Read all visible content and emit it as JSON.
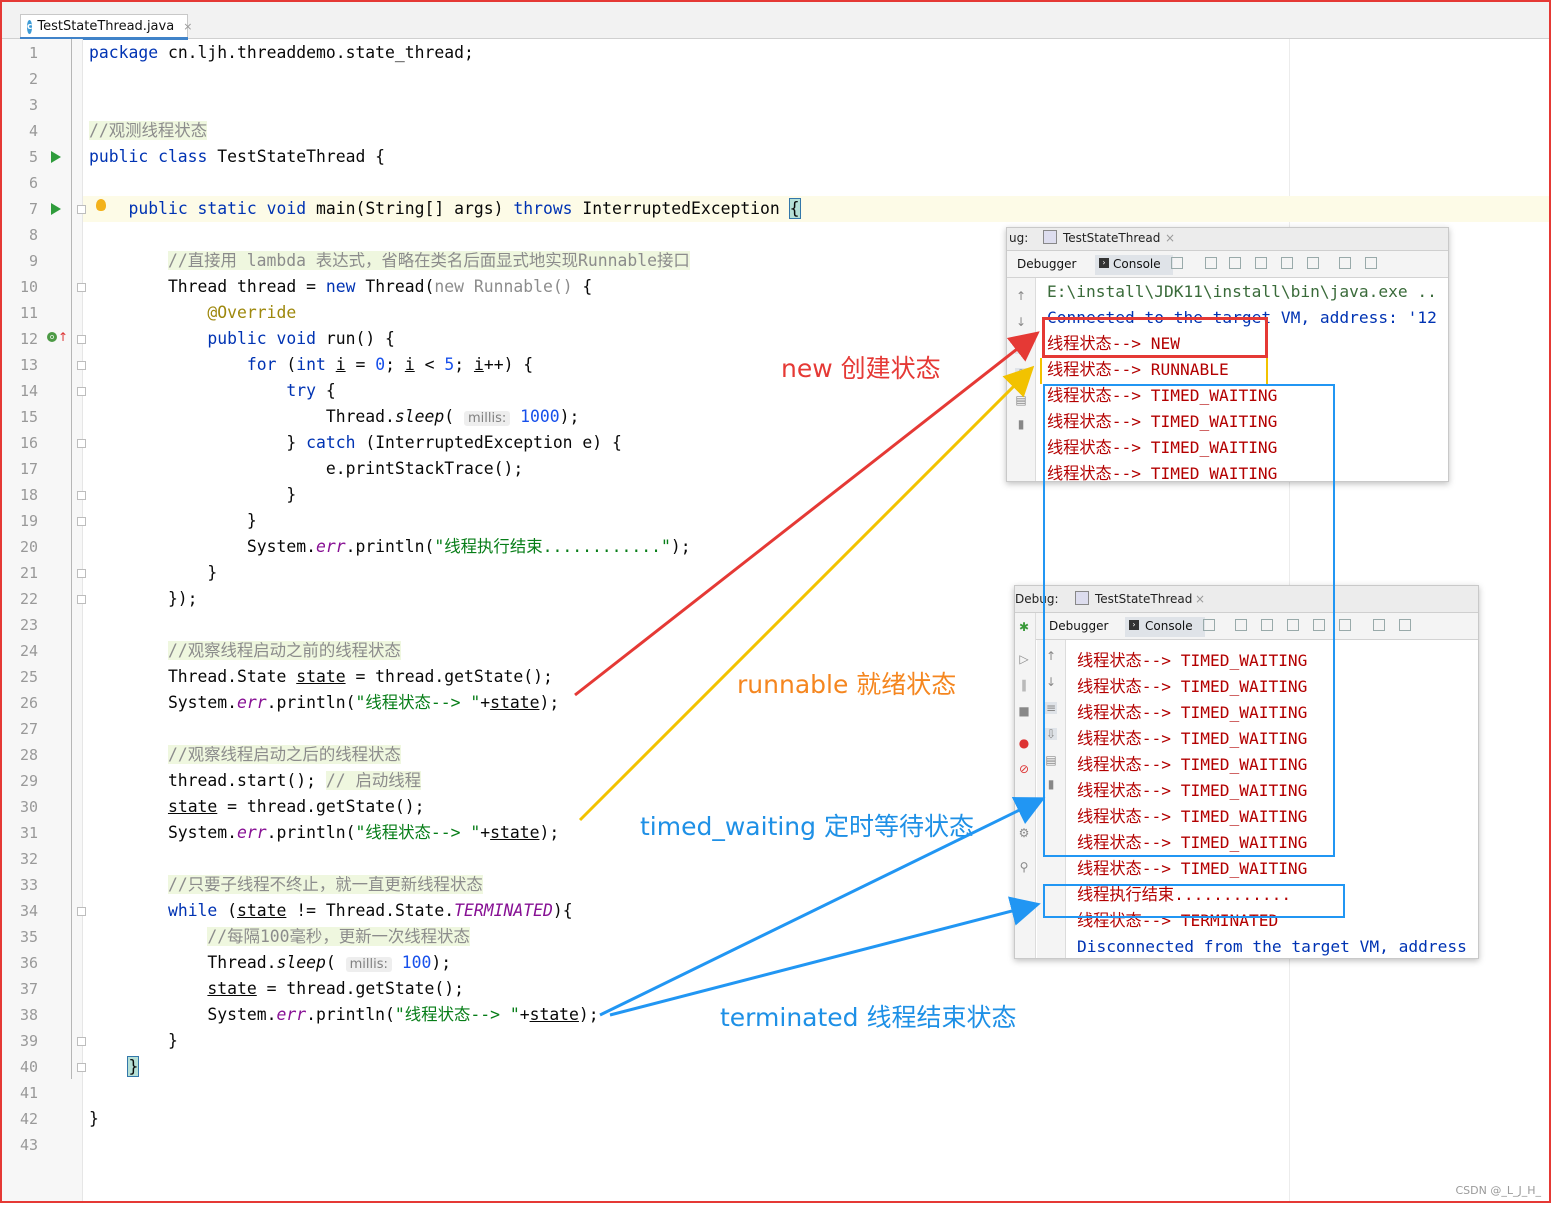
{
  "tab": {
    "filename": "TestStateThread.java",
    "close": "×",
    "icon_letter": "c"
  },
  "code": [
    {
      "n": "1",
      "html": "<span class=\"kw\">package</span> cn.ljh.threaddemo.state_thread;"
    },
    {
      "n": "2",
      "html": ""
    },
    {
      "n": "3",
      "html": ""
    },
    {
      "n": "4",
      "html": "<span class=\"cm\">//观测线程状态</span>"
    },
    {
      "n": "5",
      "html": "<span class=\"kw\">public class</span> TestStateThread {"
    },
    {
      "n": "6",
      "html": ""
    },
    {
      "n": "7",
      "html": "    <span class=\"kw\">public static void</span> main(String[] args) <span class=\"kw\">throws</span> InterruptedException <span class=\"brace-hl\">{</span>"
    },
    {
      "n": "8",
      "html": ""
    },
    {
      "n": "9",
      "html": "        <span class=\"cm\">//直接用 lambda 表达式，省略在类名后面显式地实现Runnable接口</span>"
    },
    {
      "n": "10",
      "html": "        Thread thread = <span class=\"kw\">new</span> Thread(<span style=\"color:#8c8c8c\">new Runnable()</span> {"
    },
    {
      "n": "11",
      "html": "            <span class=\"an\">@Override</span>"
    },
    {
      "n": "12",
      "html": "            <span class=\"kw\">public void</span> run() {"
    },
    {
      "n": "13",
      "html": "                <span class=\"kw\">for</span> (<span class=\"kw\">int</span> <span class=\"u\">i</span> = <span class=\"num\">0</span>; <span class=\"u\">i</span> &lt; <span class=\"num\">5</span>; <span class=\"u\">i</span>++) {"
    },
    {
      "n": "14",
      "html": "                    <span class=\"kw\">try</span> {"
    },
    {
      "n": "15",
      "html": "                        Thread.<i>sleep</i>( <span class=\"hint\">millis:</span> <span class=\"num\">1000</span>);"
    },
    {
      "n": "16",
      "html": "                    } <span class=\"kw\">catch</span> (InterruptedException e) {"
    },
    {
      "n": "17",
      "html": "                        e.printStackTrace();"
    },
    {
      "n": "18",
      "html": "                    }"
    },
    {
      "n": "19",
      "html": "                }"
    },
    {
      "n": "20",
      "html": "                System.<span class=\"ita\">err</span>.println(<span class=\"st\">\"线程执行结束............\"</span>);"
    },
    {
      "n": "21",
      "html": "            }"
    },
    {
      "n": "22",
      "html": "        });"
    },
    {
      "n": "23",
      "html": ""
    },
    {
      "n": "24",
      "html": "        <span class=\"cm\">//观察线程启动之前的线程状态</span>"
    },
    {
      "n": "25",
      "html": "        Thread.State <span class=\"u\">state</span> = thread.getState();"
    },
    {
      "n": "26",
      "html": "        System.<span class=\"ita\">err</span>.println(<span class=\"st\">\"线程状态--> \"</span>+<span class=\"u\">state</span>);"
    },
    {
      "n": "27",
      "html": ""
    },
    {
      "n": "28",
      "html": "        <span class=\"cm\">//观察线程启动之后的线程状态</span>"
    },
    {
      "n": "29",
      "html": "        thread.start(); <span class=\"cm\">// 启动线程</span>"
    },
    {
      "n": "30",
      "html": "        <span class=\"u\">state</span> = thread.getState();"
    },
    {
      "n": "31",
      "html": "        System.<span class=\"ita\">err</span>.println(<span class=\"st\">\"线程状态--> \"</span>+<span class=\"u\">state</span>);"
    },
    {
      "n": "32",
      "html": ""
    },
    {
      "n": "33",
      "html": "        <span class=\"cm\">//只要子线程不终止，就一直更新线程状态</span>"
    },
    {
      "n": "34",
      "html": "        <span class=\"kw\">while</span> (<span class=\"u\">state</span> != Thread.State.<span class=\"ita\">TERMINATED</span>){"
    },
    {
      "n": "35",
      "html": "            <span class=\"cm\">//每隔100毫秒，更新一次线程状态</span>"
    },
    {
      "n": "36",
      "html": "            Thread.<i>sleep</i>( <span class=\"hint\">millis:</span> <span class=\"num\">100</span>);"
    },
    {
      "n": "37",
      "html": "            <span class=\"u\">state</span> = thread.getState();"
    },
    {
      "n": "38",
      "html": "            System.<span class=\"ita\">err</span>.println(<span class=\"st\">\"线程状态--> \"</span>+<span class=\"u\">state</span>);"
    },
    {
      "n": "39",
      "html": "        }"
    },
    {
      "n": "40",
      "html": "    <span class=\"brace-hl\">}</span>"
    },
    {
      "n": "41",
      "html": ""
    },
    {
      "n": "42",
      "html": "}"
    },
    {
      "n": "43",
      "html": ""
    }
  ],
  "panel1": {
    "prefix": "ug:",
    "title": "TestStateThread",
    "debugger_tab": "Debugger",
    "console_tab": "Console",
    "lines": [
      "E:\\install\\JDK11\\install\\bin\\java.exe ..",
      "Connected to the target VM, address: '12",
      "线程状态--> NEW",
      "线程状态--> RUNNABLE",
      "线程状态--> TIMED_WAITING",
      "线程状态--> TIMED_WAITING",
      "线程状态--> TIMED_WAITING",
      "线程状态--> TIMED_WAITING"
    ]
  },
  "panel2": {
    "prefix": "Debug:",
    "title": "TestStateThread",
    "debugger_tab": "Debugger",
    "console_tab": "Console",
    "lines": [
      "线程状态--> TIMED_WAITING",
      "线程状态--> TIMED_WAITING",
      "线程状态--> TIMED_WAITING",
      "线程状态--> TIMED_WAITING",
      "线程状态--> TIMED_WAITING",
      "线程状态--> TIMED_WAITING",
      "线程状态--> TIMED_WAITING",
      "线程状态--> TIMED_WAITING",
      "线程状态--> TIMED_WAITING",
      "线程执行结束............",
      "线程状态--> TERMINATED",
      "Disconnected from the target VM, address"
    ]
  },
  "annotations": {
    "new_label": "new 创建状态",
    "runnable_label": "runnable 就绪状态",
    "timed_waiting_label": "timed_waiting 定时等待状态",
    "terminated_label": "terminated 线程结束状态"
  },
  "colors": {
    "red": "#e53935",
    "orange": "#f5a623",
    "yellow": "#f2c200",
    "blue": "#2196f3"
  },
  "watermark": "CSDN @_L_J_H_"
}
